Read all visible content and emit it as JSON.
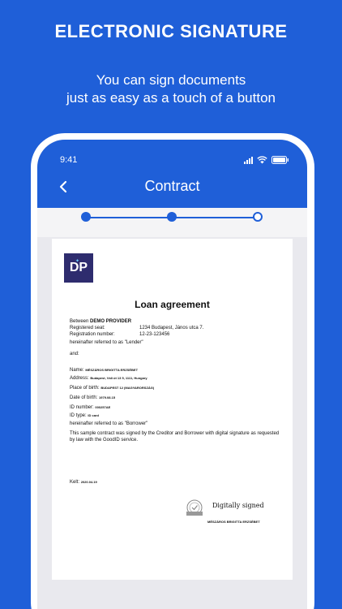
{
  "headline": "ELECTRONIC SIGNATURE",
  "subline": [
    "You can sign documents",
    "just as easy as a touch of a button"
  ],
  "status": {
    "time": "9:41"
  },
  "appbar": {
    "title": "Contract"
  },
  "stepper": {
    "steps": [
      "completed",
      "completed",
      "current"
    ]
  },
  "document": {
    "logo_text": "DP",
    "title": "Loan agreement",
    "between_label": "Between",
    "provider": "DEMO PROVIDER",
    "registered_seat_label": "Registered seat:",
    "registered_seat": "1234 Budapest, János utca 7.",
    "registration_number_label": "Registration number:",
    "registration_number": "12-23-123456",
    "lender_line": "hereinafter referred to as \"Lender\"",
    "and": "and:",
    "name_label": "Name:",
    "name": "MÉSZÁROS BRIGITTA ERZSÉBET",
    "address_label": "Address:",
    "address": "Budapest, Váli út 13 5, 1111, Hungary",
    "place_of_birth_label": "Place of birth:",
    "place_of_birth": "BUDAPEST 12 (MAGYARORSZÁG)",
    "date_of_birth_label": "Date of birth:",
    "date_of_birth": "1979.08.15",
    "id_number_label": "ID number:",
    "id_number": "000257AE",
    "id_type_label": "ID type:",
    "id_type": "ID card",
    "borrower_line": "hereinafter referred to as \"Borrower\"",
    "paragraph": "This sample contract was signed by the Creditor and Borrower with digital signature as requested by law with the GoodID service.",
    "kelt_label": "Kelt:",
    "kelt_date": "2020.04.19",
    "digitally_signed": "Digitally signed",
    "signer": "MÉSZÁROS BRIGITTA ERZSÉBET"
  }
}
